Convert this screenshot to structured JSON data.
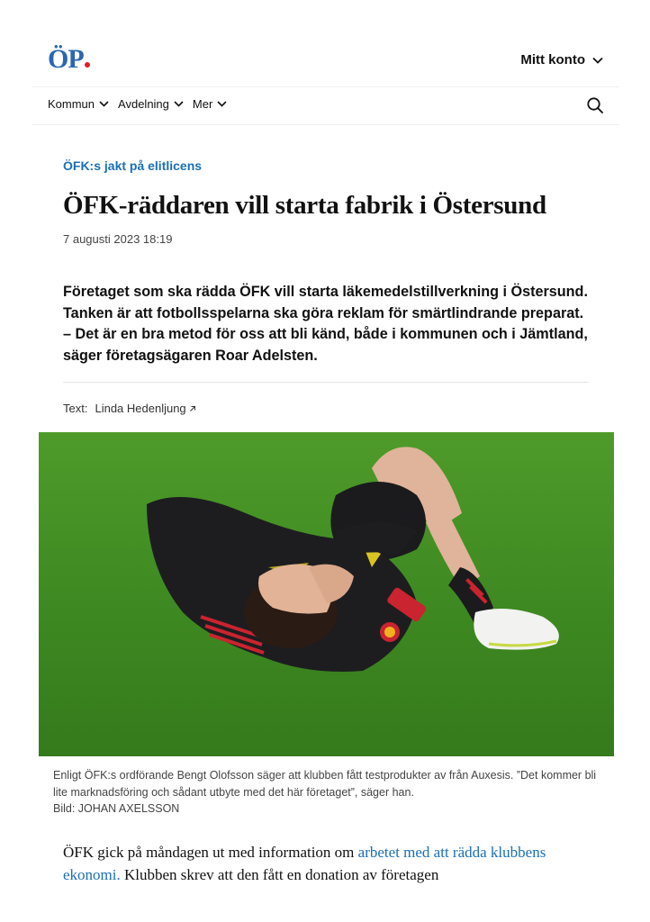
{
  "header": {
    "logo_text": "ÖP",
    "account_label": "Mitt konto",
    "brand_color": "#2a67b1",
    "accent_color": "#e01c2d"
  },
  "nav": {
    "items": [
      {
        "label": "Kommun"
      },
      {
        "label": "Avdelning"
      },
      {
        "label": "Mer"
      }
    ]
  },
  "article": {
    "kicker": "ÖFK:s jakt på elitlicens",
    "title": "ÖFK-räddaren vill starta fabrik i Östersund",
    "date": "7 augusti 2023 18:19",
    "lead": [
      "Företaget som ska rädda ÖFK vill starta läkemedelstillverkning i Östersund.",
      "Tanken är att fotbollsspelarna ska göra reklam för smärtlindrande preparat.",
      "– Det är en bra metod för oss att bli känd, både i kommunen och i Jämtland, säger företagsägaren Roar Adelsten."
    ],
    "byline_prefix": "Text:",
    "byline_author": "Linda Hedenljung",
    "image_alt": "Fotbollsspelare ligger på planen med händerna för ansiktet",
    "caption": "Enligt ÖFK:s ordförande Bengt Olofsson säger att klubben fått testprodukter av från Auxesis. ”Det kommer bli lite marknadsföring och sådant utbyte med det här företaget”, säger han.",
    "credit": "Bild: JOHAN AXELSSON",
    "body_start": "ÖFK gick på måndagen ut med information om ",
    "body_link": "arbetet med att rädda klubbens ekonomi.",
    "body_end": " Klubben skrev att den fått en donation av företagen"
  }
}
